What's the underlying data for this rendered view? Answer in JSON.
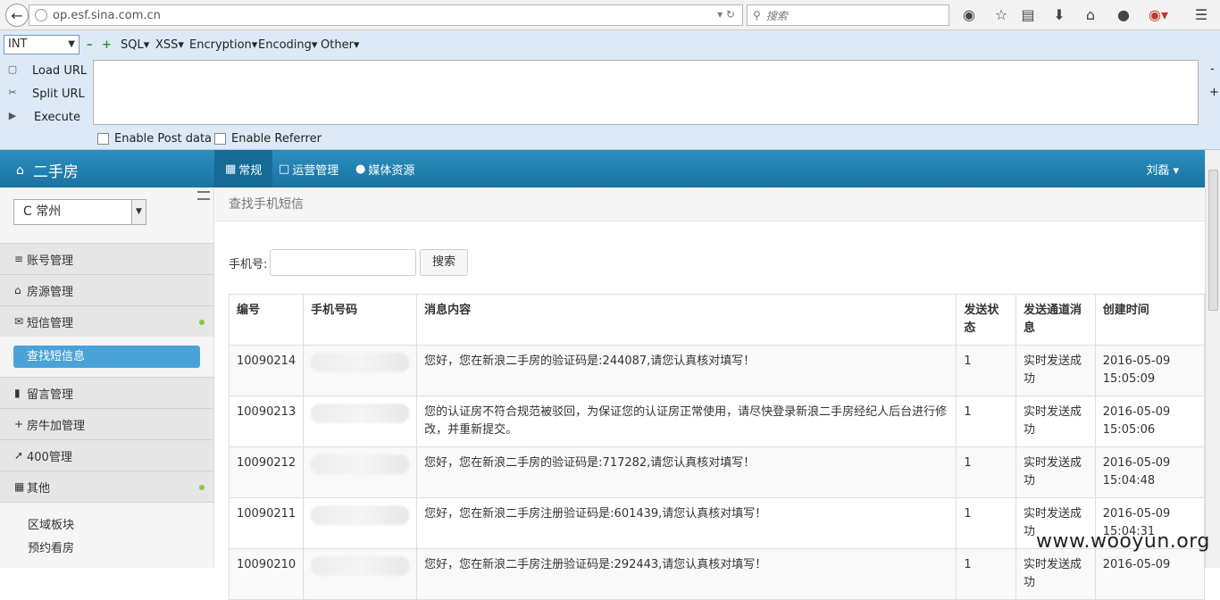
{
  "browser": {
    "url": "op.esf.sina.com.cn",
    "search_placeholder": "搜索"
  },
  "hackbar": {
    "mode": "INT",
    "menus": [
      "SQL▾",
      "XSS▾",
      "Encryption▾",
      "Encoding▾",
      "Other▾"
    ],
    "actions": [
      "Load URL",
      "Split URL",
      "Execute"
    ],
    "checks": [
      "Enable Post data",
      "Enable Referrer"
    ]
  },
  "app": {
    "brand": "二手房",
    "tabs": [
      "常规",
      "运营管理",
      "媒体资源"
    ],
    "user": "刘磊 ▾"
  },
  "sidebar": {
    "city": "C 常州",
    "items": [
      "账号管理",
      "房源管理",
      "短信管理",
      "留言管理",
      "房牛加管理",
      "400管理",
      "其他"
    ],
    "active_sub": "查找短信息",
    "sub_items": [
      "区域板块",
      "预约看房"
    ]
  },
  "main": {
    "breadcrumb": "查找手机短信",
    "search_label": "手机号:",
    "search_button": "搜索",
    "columns": [
      "编号",
      "手机号码",
      "消息内容",
      "发送状态",
      "发送通道消息",
      "创建时间"
    ],
    "rows": [
      {
        "id": "10090214",
        "content": "您好，您在新浪二手房的验证码是:244087,请您认真核对填写！",
        "status": "1",
        "channel": "实时发送成功",
        "time": "2016-05-09 15:05:09"
      },
      {
        "id": "10090213",
        "content": "您的认证房不符合规范被驳回，为保证您的认证房正常使用，请尽快登录新浪二手房经纪人后台进行修改，并重新提交。",
        "status": "1",
        "channel": "实时发送成功",
        "time": "2016-05-09 15:05:06"
      },
      {
        "id": "10090212",
        "content": "您好，您在新浪二手房的验证码是:717282,请您认真核对填写！",
        "status": "1",
        "channel": "实时发送成功",
        "time": "2016-05-09 15:04:48"
      },
      {
        "id": "10090211",
        "content": "您好，您在新浪二手房注册验证码是:601439,请您认真核对填写！",
        "status": "1",
        "channel": "实时发送成功",
        "time": "2016-05-09 15:04:31"
      },
      {
        "id": "10090210",
        "content": "您好，您在新浪二手房注册验证码是:292443,请您认真核对填写！",
        "status": "1",
        "channel": "实时发送成功",
        "time": "2016-05-09"
      }
    ]
  },
  "watermark": "www.wooyun.org"
}
